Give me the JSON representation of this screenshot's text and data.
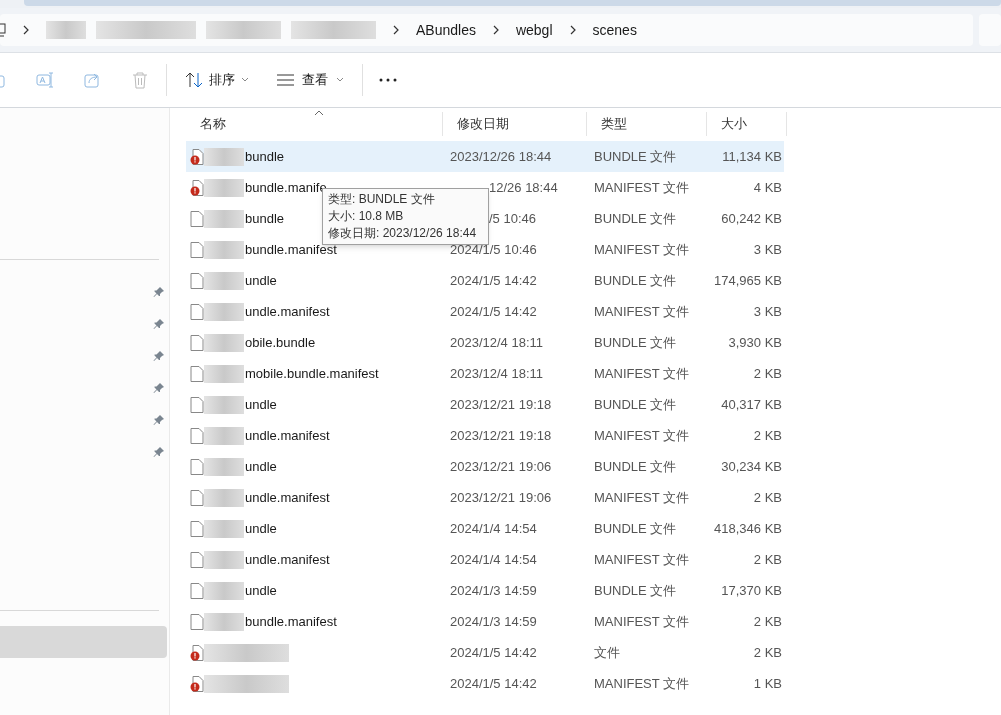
{
  "breadcrumb": [
    "ABundles",
    "webgl",
    "scenes"
  ],
  "toolbar": {
    "sort": "排序",
    "view": "查看"
  },
  "sidebar": {
    "pinned_items": [
      {
        "pinned": true
      },
      {
        "pinned": true
      },
      {
        "pinned": true
      },
      {
        "pinned": true
      },
      {
        "pinned": true
      },
      {
        "pinned": true
      }
    ],
    "items": [
      {
        "selected": true
      }
    ]
  },
  "table": {
    "columns": [
      "名称",
      "修改日期",
      "类型",
      "大小"
    ],
    "rows": [
      {
        "name": "bundle",
        "date": "2023/12/26 18:44",
        "type": "BUNDLE 文件",
        "size": "11,134 KB",
        "kind": "warning",
        "selected": true
      },
      {
        "name": "bundle.manife",
        "date": "12/26 18:44",
        "partly_hidden": true,
        "type": "MANIFEST 文件",
        "size": "4 KB",
        "kind": "warning",
        "selected": false
      },
      {
        "name": "bundle",
        "date": "/5 10:46",
        "partly_hidden": true,
        "type": "BUNDLE 文件",
        "size": "60,242 KB",
        "kind": "plain",
        "selected": false
      },
      {
        "name": "bundle.manifest",
        "date": "2024/1/5 10:46",
        "type": "MANIFEST 文件",
        "size": "3 KB",
        "kind": "plain",
        "selected": false
      },
      {
        "name": "undle",
        "date": "2024/1/5 14:42",
        "type": "BUNDLE 文件",
        "size": "174,965 KB",
        "kind": "plain",
        "selected": false
      },
      {
        "name": "undle.manifest",
        "date": "2024/1/5 14:42",
        "type": "MANIFEST 文件",
        "size": "3 KB",
        "kind": "plain",
        "selected": false
      },
      {
        "name": "obile.bundle",
        "date": "2023/12/4 18:11",
        "type": "BUNDLE 文件",
        "size": "3,930 KB",
        "kind": "plain",
        "selected": false
      },
      {
        "name": "mobile.bundle.manifest",
        "date": "2023/12/4 18:11",
        "type": "MANIFEST 文件",
        "size": "2 KB",
        "kind": "plain",
        "selected": false
      },
      {
        "name": "undle",
        "date": "2023/12/21 19:18",
        "type": "BUNDLE 文件",
        "size": "40,317 KB",
        "kind": "plain",
        "selected": false
      },
      {
        "name": "undle.manifest",
        "date": "2023/12/21 19:18",
        "type": "MANIFEST 文件",
        "size": "2 KB",
        "kind": "plain",
        "selected": false
      },
      {
        "name": "undle",
        "date": "2023/12/21 19:06",
        "type": "BUNDLE 文件",
        "size": "30,234 KB",
        "kind": "plain",
        "selected": false
      },
      {
        "name": "undle.manifest",
        "date": "2023/12/21 19:06",
        "type": "MANIFEST 文件",
        "size": "2 KB",
        "kind": "plain",
        "selected": false
      },
      {
        "name": "undle",
        "date": "2024/1/4 14:54",
        "type": "BUNDLE 文件",
        "size": "418,346 KB",
        "kind": "plain",
        "selected": false
      },
      {
        "name": "undle.manifest",
        "date": "2024/1/4 14:54",
        "type": "MANIFEST 文件",
        "size": "2 KB",
        "kind": "plain",
        "selected": false
      },
      {
        "name": "undle",
        "date": "2024/1/3 14:59",
        "type": "BUNDLE 文件",
        "size": "17,370 KB",
        "kind": "plain",
        "selected": false
      },
      {
        "name": "bundle.manifest",
        "date": "2024/1/3 14:59",
        "type": "MANIFEST 文件",
        "size": "2 KB",
        "kind": "plain",
        "selected": false
      },
      {
        "date": "2024/1/5 14:42",
        "type": "文件",
        "size": "2 KB",
        "kind": "warning",
        "selected": false
      },
      {
        "date": "2024/1/5 14:42",
        "type": "MANIFEST 文件",
        "size": "1 KB",
        "kind": "warning",
        "selected": false
      }
    ]
  },
  "tooltip": [
    "类型: BUNDLE 文件",
    "大小: 10.8 MB",
    "修改日期: 2023/12/26 18:44"
  ]
}
